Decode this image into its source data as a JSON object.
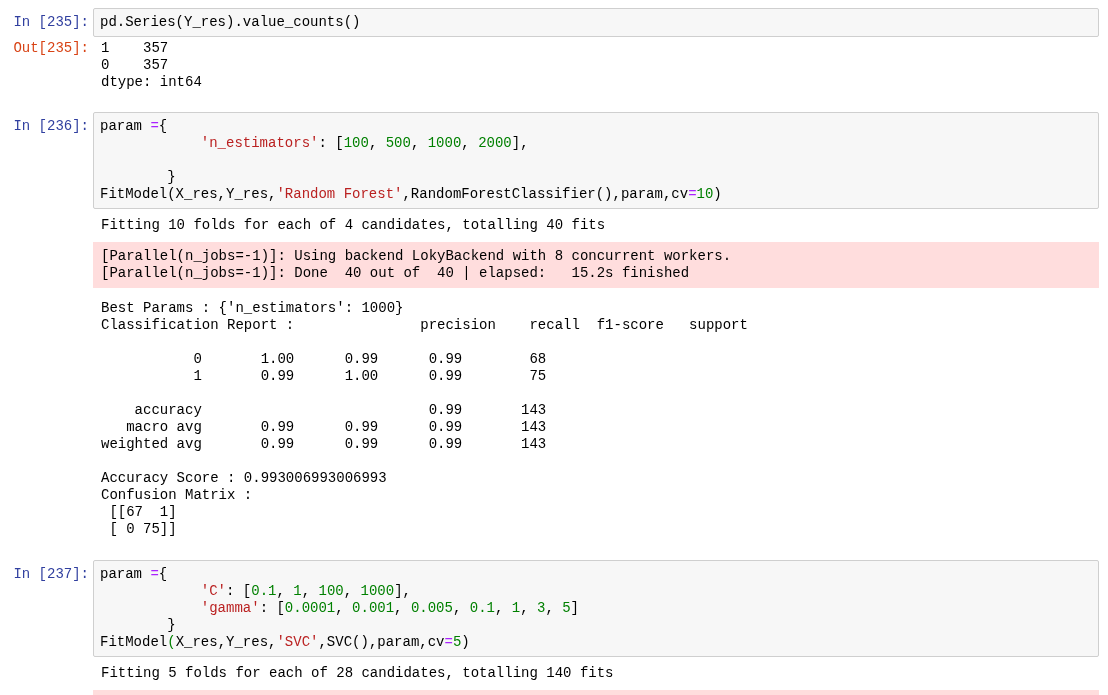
{
  "cells": [
    {
      "prompt": "In [235]:",
      "code": [
        [
          {
            "kind": "plain",
            "tokens": [
              {
                "t": "pd.Series(Y_res).value_counts()",
                "kind": "plain"
              }
            ]
          }
        ]
      ],
      "outputs": [
        {
          "kind": "result",
          "prompt": "Out[235]:",
          "blocks": [
            [
              "1    357",
              "0    357",
              "dtype: int64"
            ]
          ]
        }
      ]
    },
    {
      "prompt": "In [236]:",
      "code": [
        [
          {
            "kind": "plain",
            "tokens": [
              {
                "t": "param ",
                "kind": "plain"
              },
              {
                "t": "=",
                "kind": "op"
              },
              {
                "t": "{",
                "kind": "plain"
              }
            ]
          },
          {
            "kind": "nested",
            "tokens": [
              {
                "t": "'n_estimators'",
                "kind": "str"
              },
              {
                "t": ": [",
                "kind": "plain"
              },
              {
                "t": "100",
                "kind": "num"
              },
              {
                "t": ", ",
                "kind": "plain"
              },
              {
                "t": "500",
                "kind": "num"
              },
              {
                "t": ", ",
                "kind": "plain"
              },
              {
                "t": "1000",
                "kind": "num"
              },
              {
                "t": ", ",
                "kind": "plain"
              },
              {
                "t": "2000",
                "kind": "num"
              },
              {
                "t": "],",
                "kind": "plain"
              }
            ]
          }
        ],
        [
          {
            "kind": "plain",
            "tokens": [
              {
                "t": "        }",
                "kind": "plain"
              }
            ]
          },
          {
            "kind": "plain",
            "tokens": [
              {
                "t": "FitModel(X_res,Y_res,",
                "kind": "plain"
              },
              {
                "t": "'Random Forest'",
                "kind": "str"
              },
              {
                "t": ",RandomForestClassifier(),param,cv",
                "kind": "plain"
              },
              {
                "t": "=",
                "kind": "op"
              },
              {
                "t": "10",
                "kind": "num"
              },
              {
                "t": ")",
                "kind": "plain"
              }
            ]
          }
        ]
      ],
      "outputs": [
        {
          "kind": "stdout",
          "blocks": [
            [
              "Fitting 10 folds for each of 4 candidates, totalling 40 fits"
            ]
          ]
        },
        {
          "kind": "stderr",
          "blocks": [
            [
              "[Parallel(n_jobs=-1)]: Using backend LokyBackend with 8 concurrent workers.",
              "[Parallel(n_jobs=-1)]: Done  40 out of  40 | elapsed:   15.2s finished"
            ]
          ]
        },
        {
          "kind": "stdout",
          "blocks": [
            [
              "Best Params : {'n_estimators': 1000}",
              "Classification Report :               precision    recall  f1-score   support"
            ],
            [
              "           0       1.00      0.99      0.99        68",
              "           1       0.99      1.00      0.99        75"
            ],
            [
              "    accuracy                           0.99       143",
              "   macro avg       0.99      0.99      0.99       143",
              "weighted avg       0.99      0.99      0.99       143"
            ],
            [
              "Accuracy Score : 0.993006993006993",
              "Confusion Matrix :",
              " [[67  1]",
              " [ 0 75]]"
            ]
          ]
        }
      ]
    },
    {
      "prompt": "In [237]:",
      "code": [
        [
          {
            "kind": "plain",
            "tokens": [
              {
                "t": "param ",
                "kind": "plain"
              },
              {
                "t": "=",
                "kind": "op"
              },
              {
                "t": "{",
                "kind": "plain"
              }
            ]
          },
          {
            "kind": "nested",
            "tokens": [
              {
                "t": "'C'",
                "kind": "str"
              },
              {
                "t": ": [",
                "kind": "plain"
              },
              {
                "t": "0.1",
                "kind": "num"
              },
              {
                "t": ", ",
                "kind": "plain"
              },
              {
                "t": "1",
                "kind": "num"
              },
              {
                "t": ", ",
                "kind": "plain"
              },
              {
                "t": "100",
                "kind": "num"
              },
              {
                "t": ", ",
                "kind": "plain"
              },
              {
                "t": "1000",
                "kind": "num"
              },
              {
                "t": "],",
                "kind": "plain"
              }
            ]
          },
          {
            "kind": "nested",
            "tokens": [
              {
                "t": "'gamma'",
                "kind": "str"
              },
              {
                "t": ": [",
                "kind": "plain"
              },
              {
                "t": "0.0001",
                "kind": "num"
              },
              {
                "t": ", ",
                "kind": "plain"
              },
              {
                "t": "0.001",
                "kind": "num"
              },
              {
                "t": ", ",
                "kind": "plain"
              },
              {
                "t": "0.005",
                "kind": "num"
              },
              {
                "t": ", ",
                "kind": "plain"
              },
              {
                "t": "0.1",
                "kind": "num"
              },
              {
                "t": ", ",
                "kind": "plain"
              },
              {
                "t": "1",
                "kind": "num"
              },
              {
                "t": ", ",
                "kind": "plain"
              },
              {
                "t": "3",
                "kind": "num"
              },
              {
                "t": ", ",
                "kind": "plain"
              },
              {
                "t": "5",
                "kind": "num"
              },
              {
                "t": "]",
                "kind": "plain"
              }
            ]
          },
          {
            "kind": "plain",
            "tokens": [
              {
                "t": "        }",
                "kind": "plain"
              }
            ]
          },
          {
            "kind": "plain",
            "tokens": [
              {
                "t": "FitModel",
                "kind": "plain"
              },
              {
                "t": "(",
                "kind": "match"
              },
              {
                "t": "X_res,Y_res,",
                "kind": "plain"
              },
              {
                "t": "'SVC'",
                "kind": "str"
              },
              {
                "t": ",SVC(),param,cv",
                "kind": "plain"
              },
              {
                "t": "=",
                "kind": "op"
              },
              {
                "t": "5",
                "kind": "num"
              },
              {
                "t": ")",
                "kind": "plain"
              }
            ]
          }
        ]
      ],
      "outputs": [
        {
          "kind": "stdout",
          "blocks": [
            [
              "Fitting 5 folds for each of 28 candidates, totalling 140 fits"
            ]
          ]
        },
        {
          "kind": "stderr"
        }
      ]
    }
  ]
}
